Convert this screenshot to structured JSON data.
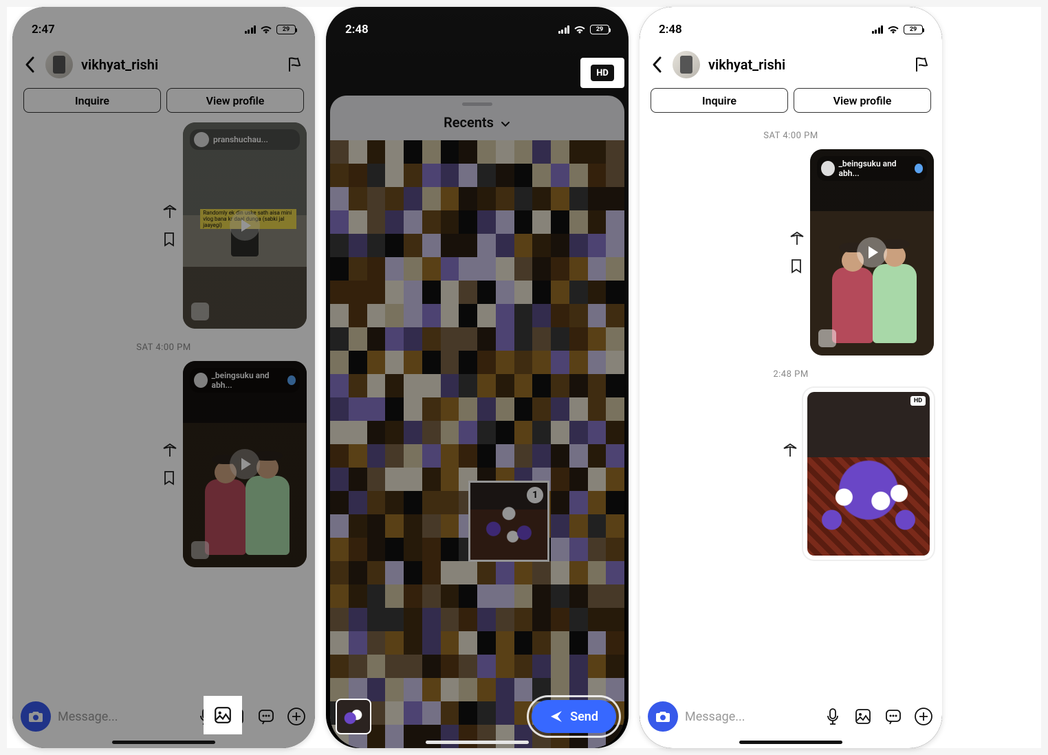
{
  "status": {
    "time_a": "2:47",
    "time_b": "2:48",
    "battery_label": "29"
  },
  "dm": {
    "username": "vikhyat_rishi",
    "inquire": "Inquire",
    "view_profile": "View profile",
    "timestamp1": "SAT 4:00 PM",
    "timestamp2": "2:48 PM",
    "reel1_user": "pranshuchau...",
    "reel1_caption": "Randomly ek din uske sath aisa mini vlog bana kr daal dunga (sabki jal jaayegi)",
    "reel2_user": "_beingsuku and abh..."
  },
  "composer": {
    "placeholder": "Message..."
  },
  "picker": {
    "title": "Recents",
    "hd": "HD",
    "selected_index": "1",
    "send": "Send"
  },
  "sent_image": {
    "hd": "HD"
  },
  "icons": {
    "back": "back-chevron-icon",
    "flag": "flag-icon",
    "share": "share-arrow-icon",
    "bookmark": "bookmark-icon",
    "camera": "camera-icon",
    "mic": "mic-icon",
    "gallery": "gallery-icon",
    "sticker": "sticker-icon",
    "plus": "plus-icon",
    "chevdown": "chevron-down-icon",
    "send": "send-plane-icon",
    "wifi": "wifi-icon",
    "signal": "cellular-signal-icon"
  }
}
